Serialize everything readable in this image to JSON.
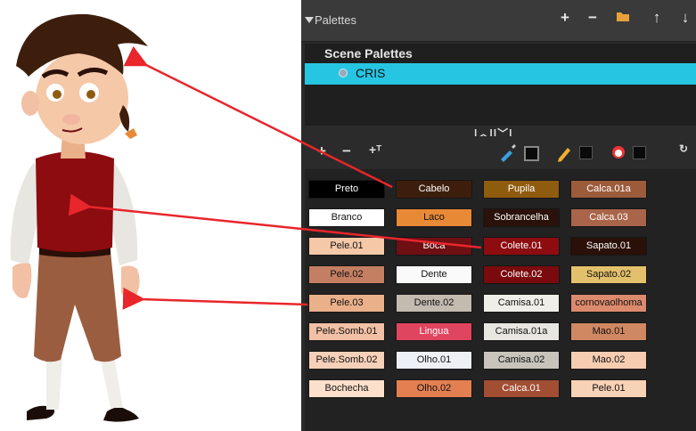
{
  "palettes_panel": {
    "title": "Palettes",
    "list_header": "Scene Palettes",
    "selected_palette": "CRIS"
  },
  "colors": {
    "red_arrow": "#e8262b",
    "selection": "#26c6e2",
    "panel_bg": "#2b2b2b"
  },
  "swatches": [
    {
      "label": "Preto",
      "color": "#000000",
      "text": "#ffffff"
    },
    {
      "label": "Cabelo",
      "color": "#3d1e0c",
      "text": "#ffffff"
    },
    {
      "label": "Pupila",
      "color": "#8f5b0e",
      "text": "#ffffff"
    },
    {
      "label": "Calca.01a",
      "color": "#9c5c3c",
      "text": "#ffffff"
    },
    {
      "label": "Branco",
      "color": "#ffffff",
      "text": "#111111"
    },
    {
      "label": "Laco",
      "color": "#e88936",
      "text": "#111111"
    },
    {
      "label": "Sobrancelha",
      "color": "#2a120a",
      "text": "#ffffff"
    },
    {
      "label": "Calca.03",
      "color": "#a9654a",
      "text": "#ffffff"
    },
    {
      "label": "Pele.01",
      "color": "#f5c8a8",
      "text": "#111111"
    },
    {
      "label": "Boca",
      "color": "#6e0f13",
      "text": "#ffffff"
    },
    {
      "label": "Colete.01",
      "color": "#8c0c10",
      "text": "#ffffff"
    },
    {
      "label": "Sapato.01",
      "color": "#2a1008",
      "text": "#ffffff"
    },
    {
      "label": "Pele.02",
      "color": "#c47f63",
      "text": "#111111"
    },
    {
      "label": "Dente",
      "color": "#fafafa",
      "text": "#111111"
    },
    {
      "label": "Colete.02",
      "color": "#7a0a0d",
      "text": "#ffffff"
    },
    {
      "label": "Sapato.02",
      "color": "#e3c06b",
      "text": "#111111"
    },
    {
      "label": "Pele.03",
      "color": "#eab08a",
      "text": "#111111"
    },
    {
      "label": "Dente.02",
      "color": "#c3bab0",
      "text": "#111111"
    },
    {
      "label": "Camisa.01",
      "color": "#efeee8",
      "text": "#111111"
    },
    {
      "label": "cornovaolhoma",
      "color": "#dc8a6e",
      "text": "#111111"
    },
    {
      "label": "Pele.Somb.01",
      "color": "#f2c0a4",
      "text": "#111111"
    },
    {
      "label": "Lingua",
      "color": "#e04560",
      "text": "#ffffff"
    },
    {
      "label": "Camisa.01a",
      "color": "#e8e6e0",
      "text": "#111111"
    },
    {
      "label": "Mao.01",
      "color": "#d08862",
      "text": "#111111"
    },
    {
      "label": "Pele.Somb.02",
      "color": "#f6d0b8",
      "text": "#111111"
    },
    {
      "label": "Olho.01",
      "color": "#eef0f8",
      "text": "#111111"
    },
    {
      "label": "Camisa.02",
      "color": "#c8c4bc",
      "text": "#111111"
    },
    {
      "label": "Mao.02",
      "color": "#f7cdb2",
      "text": "#111111"
    },
    {
      "label": "Bochecha",
      "color": "#fde0cc",
      "text": "#111111"
    },
    {
      "label": "Olho.02",
      "color": "#e47f52",
      "text": "#111111"
    },
    {
      "label": "Calca.01",
      "color": "#a14e33",
      "text": "#ffffff"
    },
    {
      "label": "Pele.01",
      "color": "#f8d2b6",
      "text": "#111111"
    }
  ]
}
